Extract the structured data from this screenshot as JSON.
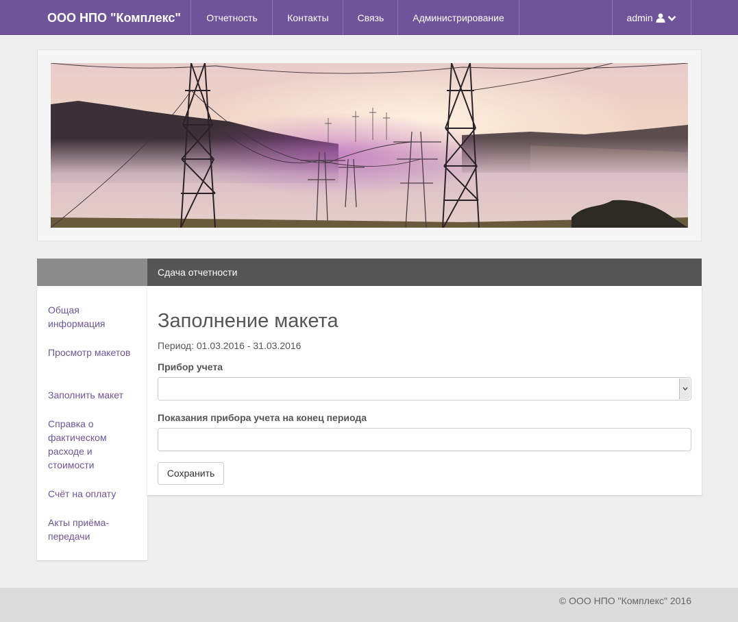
{
  "navbar": {
    "brand": "ООО НПО \"Комплекс\"",
    "items": [
      {
        "label": "Отчетность"
      },
      {
        "label": "Контакты"
      },
      {
        "label": "Связь"
      },
      {
        "label": "Администрирование"
      }
    ],
    "user": "admin",
    "user_icon": "user-icon",
    "dropdown_icon": "chevron-down-icon"
  },
  "banner": {
    "image": "power-lines-landscape"
  },
  "sidebar": {
    "items": [
      {
        "label": "Общая информация"
      },
      {
        "label": "Просмотр макетов"
      },
      {
        "label": "Заполнить макет"
      },
      {
        "label": "Справка о фактическом расходе и стоимости"
      },
      {
        "label": "Счёт на оплату"
      },
      {
        "label": "Акты приёма-передачи"
      }
    ]
  },
  "content": {
    "header": "Сдача отчетности",
    "title": "Заполнение макета",
    "period": "Период: 01.03.2016 - 31.03.2016",
    "meter_label": "Прибор учета",
    "meter_value": "",
    "reading_label": "Показания прибора учета на конец периода",
    "reading_value": "",
    "save_label": "Сохранить"
  },
  "footer": {
    "copyright": "© ООО НПО \"Комплекс\" 2016"
  },
  "colors": {
    "nav": "#6f5499",
    "link": "#6f5499",
    "header_dark": "#555555",
    "side_head": "#8c8c8c"
  }
}
